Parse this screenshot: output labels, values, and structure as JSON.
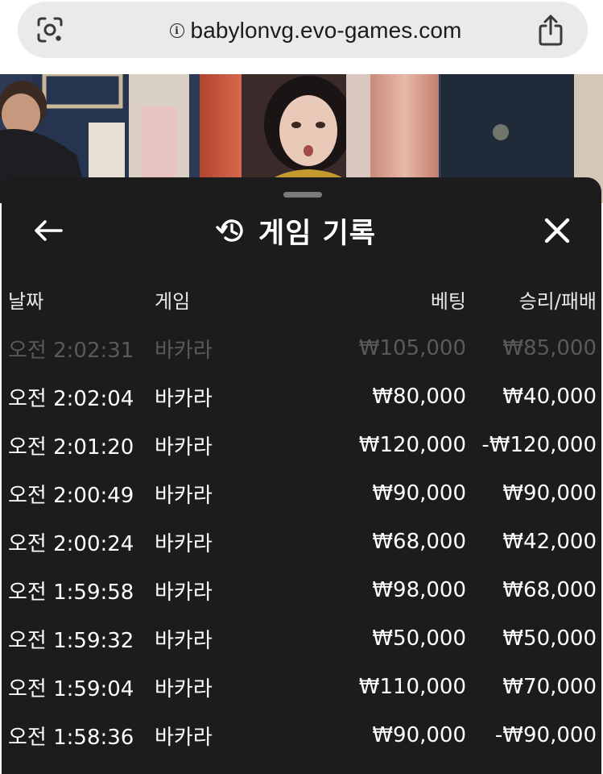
{
  "browser": {
    "url": "babylonvg.evo-games.com"
  },
  "sheet": {
    "title": "게임 기록"
  },
  "history_table": {
    "columns": {
      "date": "날짜",
      "game": "게임",
      "bet": "베팅",
      "win_loss": "승리/패배"
    },
    "rows": [
      {
        "date": "오전 2:02:31",
        "game": "바카라",
        "bet": "₩105,000",
        "win_loss": "₩85,000"
      },
      {
        "date": "오전 2:02:04",
        "game": "바카라",
        "bet": "₩80,000",
        "win_loss": "₩40,000"
      },
      {
        "date": "오전 2:01:20",
        "game": "바카라",
        "bet": "₩120,000",
        "win_loss": "-₩120,000"
      },
      {
        "date": "오전 2:00:49",
        "game": "바카라",
        "bet": "₩90,000",
        "win_loss": "₩90,000"
      },
      {
        "date": "오전 2:00:24",
        "game": "바카라",
        "bet": "₩68,000",
        "win_loss": "₩42,000"
      },
      {
        "date": "오전 1:59:58",
        "game": "바카라",
        "bet": "₩98,000",
        "win_loss": "₩68,000"
      },
      {
        "date": "오전 1:59:32",
        "game": "바카라",
        "bet": "₩50,000",
        "win_loss": "₩50,000"
      },
      {
        "date": "오전 1:59:04",
        "game": "바카라",
        "bet": "₩110,000",
        "win_loss": "₩70,000"
      },
      {
        "date": "오전 1:58:36",
        "game": "바카라",
        "bet": "₩90,000",
        "win_loss": "-₩90,000"
      }
    ]
  },
  "icons": {
    "lens": "google-lens-icon",
    "info": "info-icon",
    "share": "share-icon",
    "back": "arrow-left-icon",
    "history": "history-icon",
    "close": "close-icon"
  },
  "colors": {
    "sheet_bg": "#1c1c1c",
    "text": "#ffffff",
    "faded_text": "#5a5a5a",
    "url_bar_bg": "#e9eaec"
  }
}
